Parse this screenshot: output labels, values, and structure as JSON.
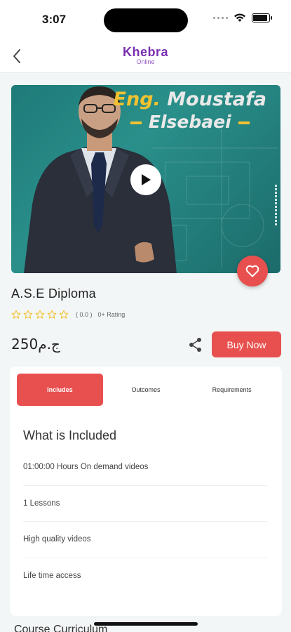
{
  "status_bar": {
    "time": "3:07",
    "battery_level": 0.9
  },
  "header": {
    "logo_main": "Khebra",
    "logo_sub": "Online"
  },
  "hero": {
    "title_prefix": "Eng.",
    "title_name": "Moustafa",
    "title_last": "Elsebaei"
  },
  "course": {
    "title": "A.S.E Diploma",
    "stars_filled": 0,
    "stars_total": 5,
    "rating_value": "( 0.0 )",
    "rating_count": "0+ Rating",
    "price": "ج.م250",
    "buy_label": "Buy Now"
  },
  "tabs": [
    {
      "label": "Includes",
      "active": true
    },
    {
      "label": "Outcomes",
      "active": false
    },
    {
      "label": "Requirements",
      "active": false
    }
  ],
  "included": {
    "title": "What is Included",
    "items": [
      "01:00:00 Hours On demand videos",
      "1 Lessons",
      "High quality videos",
      "Life time access"
    ]
  },
  "bottom": {
    "section_title": "Course Curriculum"
  },
  "colors": {
    "accent": "#e8504f",
    "brand": "#7b2fb0",
    "star": "#f2c230",
    "hero_bg": "#1e7a78"
  }
}
